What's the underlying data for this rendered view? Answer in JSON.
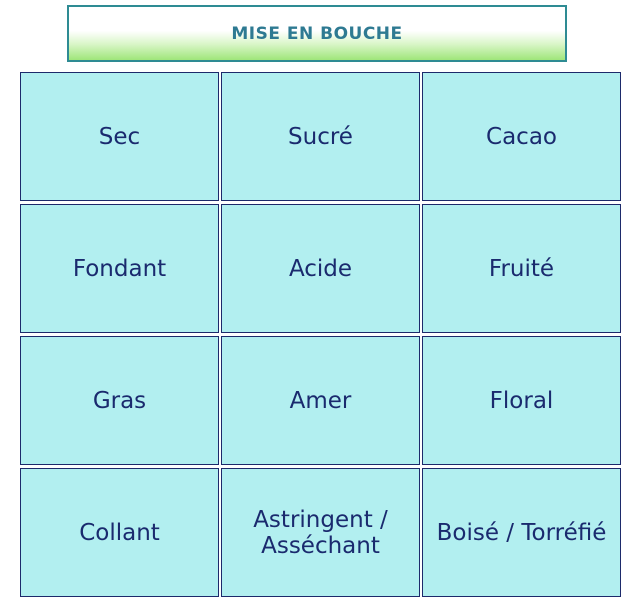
{
  "header": {
    "title": "MISE EN BOUCHE"
  },
  "grid": {
    "cells": [
      {
        "label": "Sec"
      },
      {
        "label": "Sucré"
      },
      {
        "label": "Cacao"
      },
      {
        "label": "Fondant"
      },
      {
        "label": "Acide"
      },
      {
        "label": "Fruité"
      },
      {
        "label": "Gras"
      },
      {
        "label": "Amer"
      },
      {
        "label": "Floral"
      },
      {
        "label": "Collant"
      },
      {
        "label": "Astringent / Asséchant"
      },
      {
        "label": "Boisé / Torréfié"
      }
    ]
  },
  "colors": {
    "header_border": "#2e8b93",
    "header_text": "#2e7a92",
    "header_gradient_bottom": "#9fe67a",
    "cell_background": "#b2eff0",
    "cell_border": "#1d2a6b",
    "cell_text": "#1a2a6e"
  }
}
